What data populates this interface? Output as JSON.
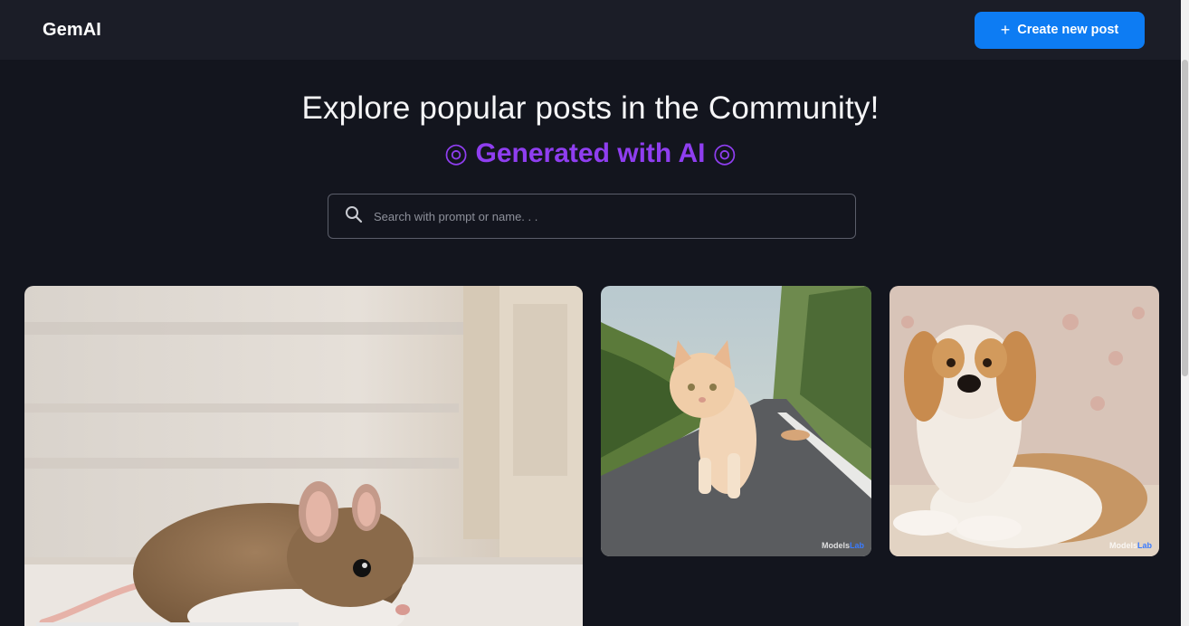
{
  "app": {
    "brand": "GemAI"
  },
  "header": {
    "create_label": "Create new post",
    "create_icon": "plus-icon"
  },
  "hero": {
    "title": "Explore popular posts in the Community!",
    "subtitle": "◎ Generated with AI ◎"
  },
  "search": {
    "placeholder": "Search with prompt or name. . .",
    "value": "",
    "icon": "search-icon"
  },
  "posts": [
    {
      "subject": "mouse"
    },
    {
      "subject": "cat",
      "watermark_a": "Models",
      "watermark_b": "Lab"
    },
    {
      "subject": "dog",
      "watermark_a": "Models",
      "watermark_b": "Lab"
    }
  ],
  "colors": {
    "accent": "#0d7cf3",
    "purple": "#8f3ef0",
    "background": "#13151e",
    "navbar": "#1b1d27"
  }
}
